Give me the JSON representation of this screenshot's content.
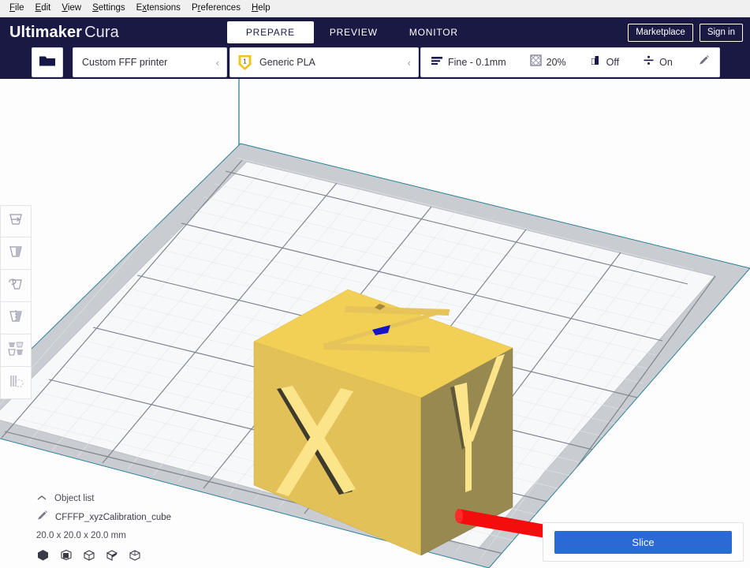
{
  "menubar": {
    "items": [
      {
        "pre": "",
        "accel": "F",
        "post": "ile"
      },
      {
        "pre": "",
        "accel": "E",
        "post": "dit"
      },
      {
        "pre": "",
        "accel": "V",
        "post": "iew"
      },
      {
        "pre": "",
        "accel": "S",
        "post": "ettings"
      },
      {
        "pre": "E",
        "accel": "x",
        "post": "tensions"
      },
      {
        "pre": "P",
        "accel": "r",
        "post": "eferences"
      },
      {
        "pre": "",
        "accel": "H",
        "post": "elp"
      }
    ]
  },
  "header": {
    "brand_bold": "Ultimaker",
    "brand_light": "Cura",
    "tabs": [
      {
        "label": "PREPARE",
        "active": true
      },
      {
        "label": "PREVIEW",
        "active": false
      },
      {
        "label": "MONITOR",
        "active": false
      }
    ],
    "marketplace_label": "Marketplace",
    "signin_label": "Sign in",
    "bg_color": "#191944"
  },
  "toolbar": {
    "open_file_icon": "folder-open-icon",
    "printer": {
      "name": "Custom FFF printer",
      "chevron": "chevron-left-icon"
    },
    "material": {
      "extruder_number": "1",
      "name": "Generic PLA",
      "chevron": "chevron-left-icon",
      "tag_color": "#f0c419"
    },
    "print_setup": {
      "profile_label": "Fine - 0.1mm",
      "profile_icon": "layer-height-icon",
      "infill_label": "20%",
      "infill_icon": "infill-icon",
      "support_label": "Off",
      "support_icon": "support-icon",
      "adhesion_label": "On",
      "adhesion_icon": "adhesion-icon",
      "edit_icon": "pencil-icon"
    }
  },
  "tools": [
    {
      "name": "move-tool",
      "icon": "move-icon"
    },
    {
      "name": "scale-tool",
      "icon": "scale-icon"
    },
    {
      "name": "rotate-tool",
      "icon": "rotate-icon"
    },
    {
      "name": "mirror-tool",
      "icon": "mirror-icon"
    },
    {
      "name": "per-model-settings-tool",
      "icon": "per-model-settings-icon"
    },
    {
      "name": "support-blocker-tool",
      "icon": "support-blocker-icon"
    }
  ],
  "object_list": {
    "header_label": "Object list",
    "collapse_icon": "chevron-up-icon",
    "item": {
      "name": "CFFFP_xyzCalibration_cube",
      "icon": "pencil-icon"
    },
    "dimensions": "20.0 x 20.0 x 20.0 mm",
    "view_icons": [
      "cube-solid-icon",
      "cube-shaded-icon",
      "cube-outline-icon",
      "cube-open-icon",
      "cube-wireframe-icon"
    ]
  },
  "slice_panel": {
    "button_label": "Slice",
    "button_color": "#2a6ad4"
  },
  "viewport": {
    "model_name": "xyzCalibration_cube",
    "model_faces": {
      "top": "#f2cf55",
      "front": "#e2c158",
      "right": "#97894f"
    },
    "axis_colors": {
      "x": "#f40d0d",
      "z": "#1414c8",
      "z_line": "#2c7f96"
    },
    "plate_color": "#f4f5f7",
    "plate_border_color": "#c9cdd2",
    "grid_line_color": "#707880"
  }
}
